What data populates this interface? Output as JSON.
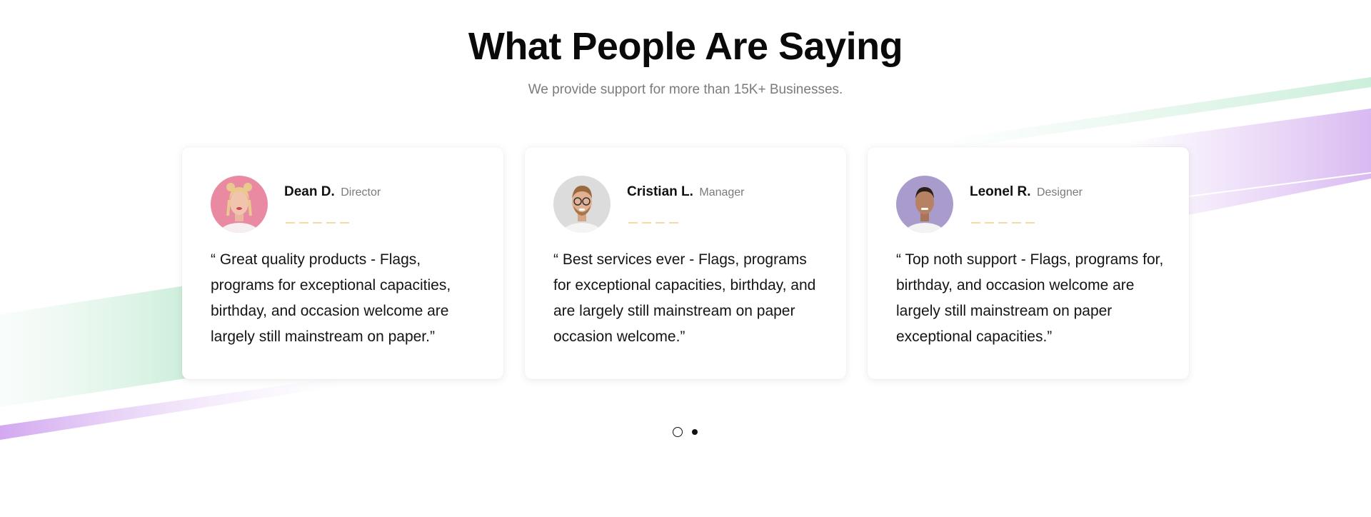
{
  "section": {
    "title": "What People Are Saying",
    "subtitle": "We provide support for more than 15K+ Businesses."
  },
  "testimonials": [
    {
      "name": "Dean D.",
      "role": "Director",
      "quote": "“ Great quality products - Flags, programs for exceptional capacities, birthday, and occasion welcome are largely still mainstream on paper.”",
      "stars": 5,
      "avatar_bg": "#e98aa2"
    },
    {
      "name": "Cristian L.",
      "role": "Manager",
      "quote": "“ Best services ever - Flags, programs for exceptional capacities, birthday, and are largely still mainstream on paper occasion welcome.”",
      "stars": 4,
      "avatar_bg": "#d9d9d9"
    },
    {
      "name": "Leonel R.",
      "role": "Designer",
      "quote": "“ Top noth support - Flags, programs for, birthday, and occasion welcome are largely still mainstream on paper exceptional capacities.”",
      "stars": 5,
      "avatar_bg": "#a99bcc"
    }
  ],
  "pagination": {
    "pages": 2,
    "active_page": 2
  },
  "colors": {
    "accent_green": "#d4f0e0",
    "accent_purple": "#d8b8f0",
    "star": "#f7d9a6",
    "text_primary": "#111111",
    "text_muted": "#7b7b7b"
  }
}
